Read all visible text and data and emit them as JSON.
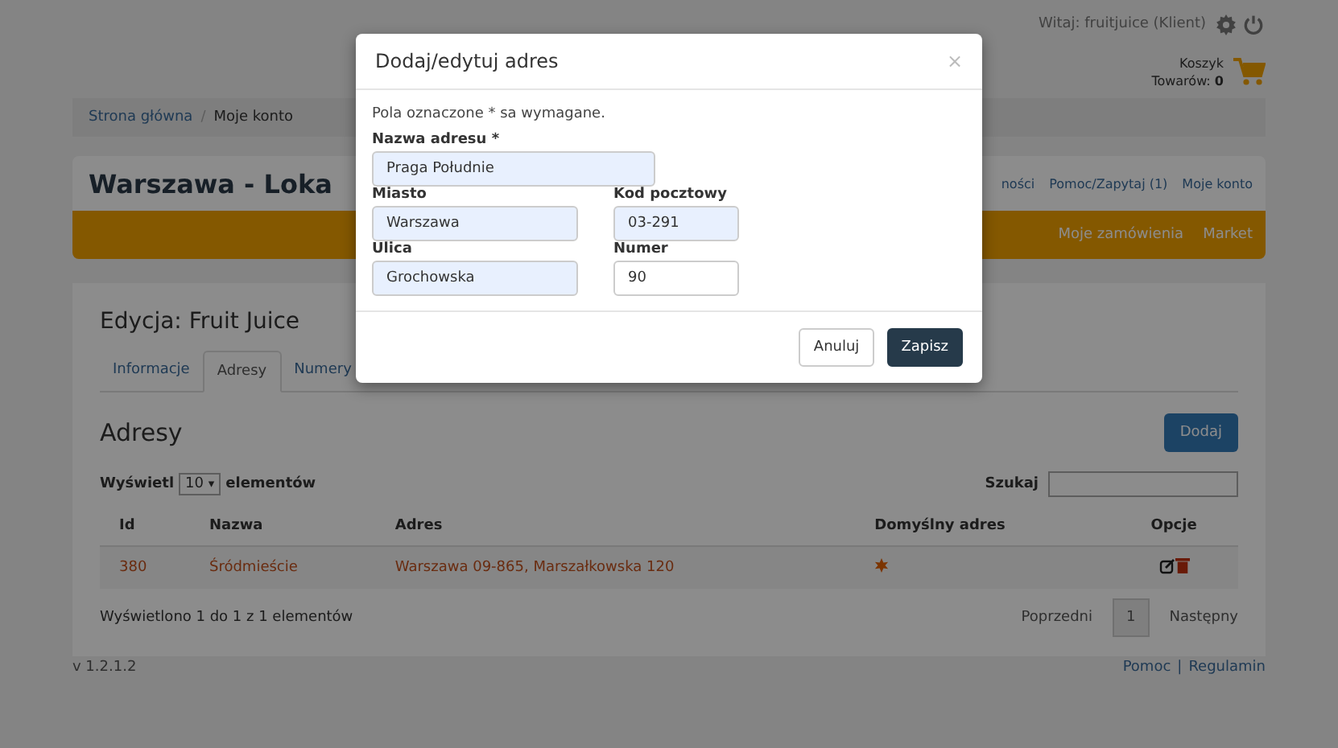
{
  "header": {
    "welcome": "Witaj: fruitjuice (Klient)",
    "cart_label": "Koszyk",
    "cart_count_label": "Towarów:",
    "cart_count": "0"
  },
  "breadcrumb": [
    "Strona główna",
    "Moje konto"
  ],
  "breadcrumb_separator": "/",
  "title": "Warszawa - Loka",
  "top_nav": [
    "ności",
    "Pomoc/Zapytaj (1)",
    "Moje konto"
  ],
  "orange_nav": [
    "Moje zamówienia",
    "Market"
  ],
  "panel": {
    "heading": "Edycja: Fruit Juice",
    "tabs": [
      {
        "label": "Informacje",
        "selected": false
      },
      {
        "label": "Adresy",
        "selected": true
      },
      {
        "label": "Numery",
        "selected": false
      }
    ],
    "section_title": "Adresy",
    "add_button": "Dodaj",
    "length_label_before": "Wyświetl",
    "length_value": "10",
    "length_caret": "▾",
    "length_label_after": "elementów",
    "search_label": "Szukaj",
    "table": {
      "columns": [
        "Id",
        "Nazwa",
        "Adres",
        "Domyślny adres",
        "Opcje"
      ],
      "rows": [
        {
          "id": "380",
          "name": "Śródmieście",
          "address": "Warszawa 09-865, Marszałkowska 120",
          "default": true
        }
      ]
    },
    "info": "Wyświetlono 1 do 1 z 1 elementów",
    "prev": "Poprzedni",
    "page": "1",
    "next": "Następny"
  },
  "footer": {
    "version": "v 1.2.1.2",
    "links": [
      "Pomoc",
      "Regulamin"
    ],
    "separator": "|"
  },
  "modal": {
    "title": "Dodaj/edytuj adres",
    "close": "×",
    "note": "Pola oznaczone * sa wymagane.",
    "fields": [
      {
        "label": "Nazwa adresu *",
        "value": "Praga Południe",
        "filled": true
      },
      {
        "label": "Miasto",
        "value": "Warszawa",
        "filled": true
      },
      {
        "label": "Kod pocztowy",
        "value": "03-291",
        "filled": true
      },
      {
        "label": "Ulica",
        "value": "Grochowska",
        "filled": true
      },
      {
        "label": "Numer",
        "value": "90",
        "filled": false
      }
    ],
    "cancel": "Anuluj",
    "save": "Zapisz"
  }
}
